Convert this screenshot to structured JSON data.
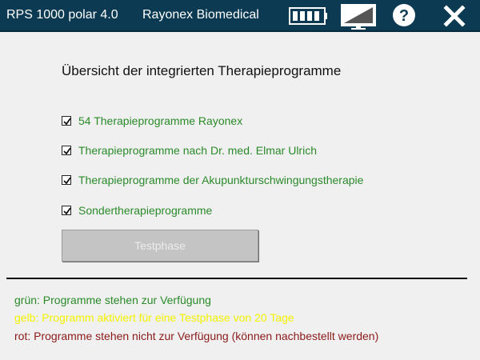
{
  "header": {
    "app_title": "RPS 1000 polar 4.0",
    "company": "Rayonex Biomedical"
  },
  "icons": {
    "battery": "battery-icon",
    "monitor": "monitor-icon",
    "help": "help-icon",
    "close": "close-icon"
  },
  "main": {
    "heading": "Übersicht der integrierten Therapieprogramme",
    "options": [
      {
        "label": "54 Therapieprogramme Rayonex",
        "checked": true
      },
      {
        "label": "Therapieprogramme nach Dr. med. Elmar Ulrich",
        "checked": true
      },
      {
        "label": "Therapieprogramme der Akupunkturschwingungstherapie",
        "checked": true
      },
      {
        "label": "Sondertherapieprogramme",
        "checked": true
      }
    ],
    "test_button": "Testphase"
  },
  "legend": {
    "green": "grün: Programme stehen zur Verfügung",
    "yellow": "gelb: Programm aktiviert für eine Testphase von 20 Tage",
    "red": "rot: Programme stehen nicht zur Verfügung (können nachbestellt werden)"
  },
  "colors": {
    "header_bg": "#0b3a52",
    "available": "#2a8a2a",
    "trial": "#f2f200",
    "unavailable": "#8b1a1a"
  }
}
